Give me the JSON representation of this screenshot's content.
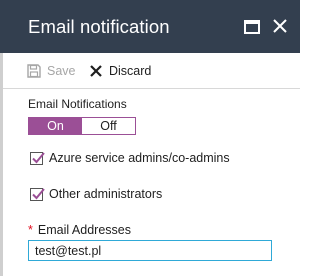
{
  "header": {
    "title": "Email notification"
  },
  "toolbar": {
    "save_label": "Save",
    "discard_label": "Discard"
  },
  "notifications": {
    "section_label": "Email Notifications",
    "toggle_on_label": "On",
    "toggle_off_label": "Off",
    "selected": "On"
  },
  "checkboxes": [
    {
      "label": "Azure service admins/co-admins",
      "checked": true
    },
    {
      "label": "Other administrators",
      "checked": true
    }
  ],
  "email": {
    "required_marker": "*",
    "label": "Email Addresses",
    "value": "test@test.pl"
  },
  "colors": {
    "header_bg": "#333f4f",
    "accent_purple": "#9b4f96",
    "input_border": "#2fa9d7",
    "required_red": "#e00b1c"
  }
}
